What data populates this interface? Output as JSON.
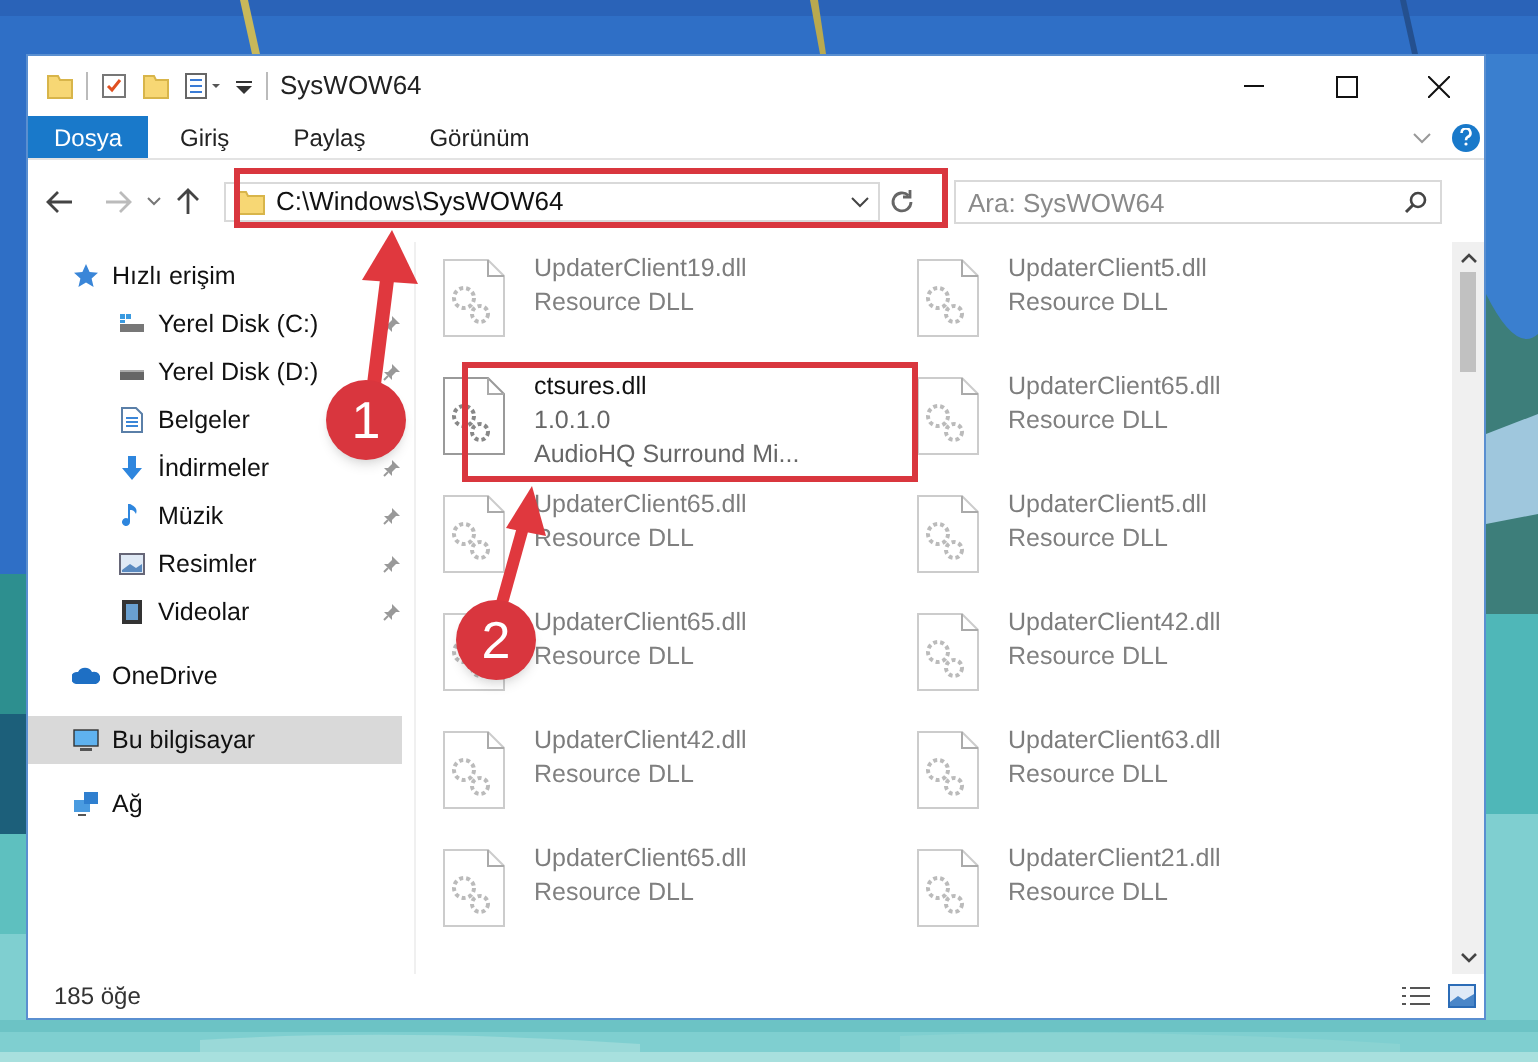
{
  "window": {
    "title": "SysWOW64"
  },
  "ribbon_tabs": [
    {
      "label": "Dosya",
      "selected": true
    },
    {
      "label": "Giriş",
      "selected": false
    },
    {
      "label": "Paylaş",
      "selected": false
    },
    {
      "label": "Görünüm",
      "selected": false
    }
  ],
  "address_bar": {
    "path": "C:\\Windows\\SysWOW64"
  },
  "search": {
    "placeholder": "Ara: SysWOW64"
  },
  "sidebar": {
    "items": [
      {
        "label": "Hızlı erişim",
        "kind": "quick",
        "selected": false,
        "children": [
          {
            "label": "Yerel Disk (C:)",
            "kind": "diskc",
            "pinned": true,
            "selected": false
          },
          {
            "label": "Yerel Disk (D:)",
            "kind": "disk",
            "pinned": true,
            "selected": false
          },
          {
            "label": "Belgeler",
            "kind": "docs",
            "selected": false
          },
          {
            "label": "İndirmeler",
            "kind": "downloads",
            "pinned": true,
            "selected": false
          },
          {
            "label": "Müzik",
            "kind": "music",
            "pinned": true,
            "selected": false
          },
          {
            "label": "Resimler",
            "kind": "pictures",
            "pinned": true,
            "selected": false
          },
          {
            "label": "Videolar",
            "kind": "videos",
            "pinned": true,
            "selected": false
          }
        ]
      },
      {
        "label": "OneDrive",
        "kind": "cloud",
        "selected": false
      },
      {
        "label": "Bu bilgisayar",
        "kind": "pc",
        "selected": true
      },
      {
        "label": "Ağ",
        "kind": "network",
        "selected": false
      }
    ]
  },
  "files": [
    {
      "name": "UpdaterClient19.dll",
      "lines": [
        "Resource DLL"
      ],
      "faded": true
    },
    {
      "name": "UpdaterClient5.dll",
      "lines": [
        "Resource DLL"
      ],
      "faded": true
    },
    {
      "name": "ctsures.dll",
      "lines": [
        "1.0.1.0",
        "AudioHQ Surround Mi..."
      ],
      "faded": false
    },
    {
      "name": "UpdaterClient65.dll",
      "lines": [
        "Resource DLL"
      ],
      "faded": true
    },
    {
      "name": "UpdaterClient65.dll",
      "lines": [
        "Resource DLL"
      ],
      "faded": true
    },
    {
      "name": "UpdaterClient5.dll",
      "lines": [
        "Resource DLL"
      ],
      "faded": true
    },
    {
      "name": "UpdaterClient65.dll",
      "lines": [
        "Resource DLL"
      ],
      "faded": true
    },
    {
      "name": "UpdaterClient42.dll",
      "lines": [
        "Resource DLL"
      ],
      "faded": true
    },
    {
      "name": "UpdaterClient42.dll",
      "lines": [
        "Resource DLL"
      ],
      "faded": true
    },
    {
      "name": "UpdaterClient63.dll",
      "lines": [
        "Resource DLL"
      ],
      "faded": true
    },
    {
      "name": "UpdaterClient65.dll",
      "lines": [
        "Resource DLL"
      ],
      "faded": true
    },
    {
      "name": "UpdaterClient21.dll",
      "lines": [
        "Resource DLL"
      ],
      "faded": true
    }
  ],
  "status_bar": {
    "item_count": "185 öğe"
  },
  "annotations": [
    {
      "label": "1"
    },
    {
      "label": "2"
    }
  ]
}
